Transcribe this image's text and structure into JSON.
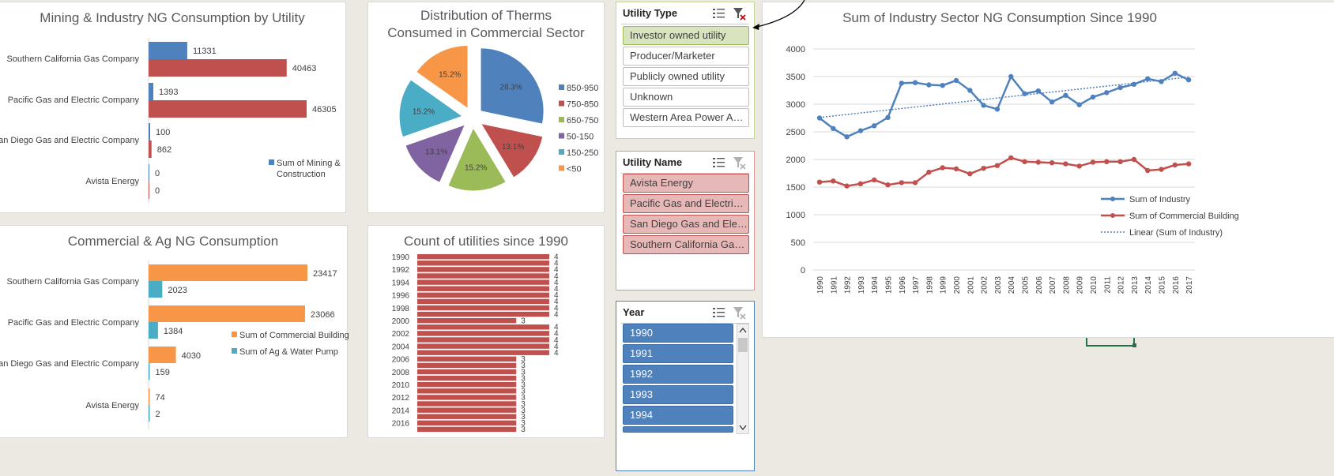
{
  "colors": {
    "blue": "#4f81bd",
    "red": "#c0504d",
    "green": "#9bbb59",
    "purple": "#8064a2",
    "teal": "#4bacc6",
    "orange": "#f79646",
    "slicer_selected_green": "#d7e4bd",
    "slicer_selected_red": "#e6b8b7",
    "slicer_selected_blue": "#4f81bd"
  },
  "chart_data": [
    {
      "type": "bar",
      "title": "Mining & Industry NG Consumption by Utility",
      "categories": [
        "Southern California Gas Company",
        "Pacific Gas and Electric Company",
        "San Diego Gas and Electric Company",
        "Avista Energy"
      ],
      "series": [
        {
          "name": "Sum of Mining & Construction",
          "values": [
            11331,
            1393,
            100,
            0
          ]
        },
        {
          "name": "",
          "values": [
            40463,
            46305,
            862,
            0
          ]
        }
      ],
      "legend": [
        "Sum of Mining &",
        "Construction"
      ]
    },
    {
      "type": "pie",
      "title": [
        "Distribution of Therms",
        "Consumed in Commercial Sector"
      ],
      "labels": [
        "850-950",
        "750-850",
        "650-750",
        "50-150",
        "150-250",
        "<50"
      ],
      "values": [
        28.3,
        13.1,
        15.2,
        13.1,
        15.2,
        15.2
      ],
      "data_labels": [
        "28.3%",
        "13.1%",
        "15.2%",
        "13.1%",
        "15.2%",
        "15.2%"
      ],
      "legend_position": "right"
    },
    {
      "type": "bar",
      "title": "Commercial & Ag NG Consumption",
      "categories": [
        "Southern California Gas Company",
        "Pacific Gas and Electric Company",
        "San Diego Gas and Electric Company",
        "Avista Energy"
      ],
      "series": [
        {
          "name": "Sum of Commercial Building",
          "values": [
            23417,
            23066,
            4030,
            74
          ]
        },
        {
          "name": "Sum of Ag & Water Pump",
          "values": [
            2023,
            1384,
            159,
            2
          ]
        }
      ]
    },
    {
      "type": "bar",
      "title": "Count of utilities since 1990",
      "categories": [
        "1990",
        "1991",
        "1992",
        "1993",
        "1994",
        "1995",
        "1996",
        "1997",
        "1998",
        "1999",
        "2000",
        "2001",
        "2002",
        "2003",
        "2004",
        "2005",
        "2006",
        "2007",
        "2008",
        "2009",
        "2010",
        "2011",
        "2012",
        "2013",
        "2014",
        "2015",
        "2016",
        "2017"
      ],
      "tick_labels": [
        "1990",
        "1992",
        "1994",
        "1996",
        "1998",
        "2000",
        "2002",
        "2004",
        "2006",
        "2008",
        "2010",
        "2012",
        "2014",
        "2016"
      ],
      "values": [
        4,
        4,
        4,
        4,
        4,
        4,
        4,
        4,
        4,
        4,
        3,
        4,
        4,
        4,
        4,
        4,
        3,
        3,
        3,
        3,
        3,
        3,
        3,
        3,
        3,
        3,
        3,
        3
      ]
    },
    {
      "type": "line",
      "title": "Sum of Industry Sector NG Consumption Since 1990",
      "x": [
        "1990",
        "1991",
        "1992",
        "1993",
        "1994",
        "1995",
        "1996",
        "1997",
        "1998",
        "1999",
        "2000",
        "2001",
        "2002",
        "2003",
        "2004",
        "2005",
        "2006",
        "2007",
        "2008",
        "2009",
        "2010",
        "2011",
        "2012",
        "2013",
        "2014",
        "2015",
        "2016",
        "2017"
      ],
      "series": [
        {
          "name": "Sum of Industry",
          "values": [
            2750,
            2560,
            2410,
            2520,
            2610,
            2760,
            3380,
            3390,
            3350,
            3340,
            3430,
            3250,
            2980,
            2910,
            3500,
            3190,
            3240,
            3040,
            3160,
            2990,
            3130,
            3210,
            3300,
            3360,
            3460,
            3410,
            3560,
            3440
          ]
        },
        {
          "name": "Sum of Commercial Building",
          "values": [
            1590,
            1610,
            1520,
            1560,
            1630,
            1540,
            1580,
            1580,
            1770,
            1850,
            1830,
            1740,
            1840,
            1890,
            2030,
            1960,
            1950,
            1940,
            1920,
            1880,
            1950,
            1960,
            1960,
            2000,
            1800,
            1820,
            1900,
            1920
          ]
        }
      ],
      "trendline": {
        "name": "Linear (Sum of Industry)",
        "start": 2760,
        "end": 3490
      },
      "ylim": [
        0,
        4000
      ],
      "yticks": [
        "0",
        "500",
        "1000",
        "1500",
        "2000",
        "2500",
        "3000",
        "3500",
        "4000"
      ],
      "grid": true,
      "legend_position": "right"
    }
  ],
  "slicers": {
    "utility_type": {
      "title": "Utility Type",
      "items": [
        "Investor owned utility",
        "Producer/Marketer",
        "Publicly owned utility",
        "Unknown",
        "Western Area Power Age..."
      ]
    },
    "utility_name": {
      "title": "Utility Name",
      "items": [
        "Avista Energy",
        "Pacific Gas and Electric C...",
        "San Diego Gas and Electr...",
        "Southern California Gas C..."
      ]
    },
    "year": {
      "title": "Year",
      "items": [
        "1990",
        "1991",
        "1992",
        "1993",
        "1994"
      ]
    }
  }
}
